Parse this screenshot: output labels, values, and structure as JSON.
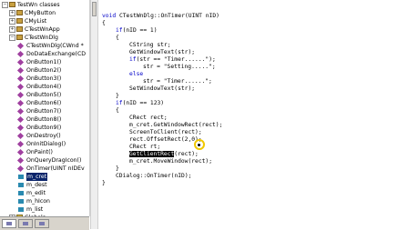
{
  "classview": {
    "items": [
      {
        "label": "TestWn classes",
        "level": 0,
        "icon": "classes-root-icon",
        "exp": "-"
      },
      {
        "label": "CMyButton",
        "level": 1,
        "icon": "class-icon",
        "exp": "+"
      },
      {
        "label": "CMyList",
        "level": 1,
        "icon": "class-icon",
        "exp": "+"
      },
      {
        "label": "CTestWnApp",
        "level": 1,
        "icon": "class-icon",
        "exp": "+"
      },
      {
        "label": "CTestWnDlg",
        "level": 1,
        "icon": "class-icon",
        "exp": "-"
      },
      {
        "label": "CTestWnDlg(CWnd *",
        "level": 2,
        "icon": "method-icon"
      },
      {
        "label": "DoDataExchange(CD",
        "level": 2,
        "icon": "method-icon"
      },
      {
        "label": "OnButton1()",
        "level": 2,
        "icon": "method-icon"
      },
      {
        "label": "OnButton2()",
        "level": 2,
        "icon": "method-icon"
      },
      {
        "label": "OnButton3()",
        "level": 2,
        "icon": "method-icon"
      },
      {
        "label": "OnButton4()",
        "level": 2,
        "icon": "method-icon"
      },
      {
        "label": "OnButton5()",
        "level": 2,
        "icon": "method-icon"
      },
      {
        "label": "OnButton6()",
        "level": 2,
        "icon": "method-icon"
      },
      {
        "label": "OnButton7()",
        "level": 2,
        "icon": "method-icon"
      },
      {
        "label": "OnButton8()",
        "level": 2,
        "icon": "method-icon"
      },
      {
        "label": "OnButton9()",
        "level": 2,
        "icon": "method-icon"
      },
      {
        "label": "OnDestroy()",
        "level": 2,
        "icon": "method-icon"
      },
      {
        "label": "OnInitDialog()",
        "level": 2,
        "icon": "method-icon"
      },
      {
        "label": "OnPaint()",
        "level": 2,
        "icon": "method-icon"
      },
      {
        "label": "OnQueryDragIcon()",
        "level": 2,
        "icon": "method-icon"
      },
      {
        "label": "OnTimer(UINT nIDEv",
        "level": 2,
        "icon": "method-icon"
      },
      {
        "label": "m_cret",
        "level": 2,
        "icon": "member-icon",
        "selected": true
      },
      {
        "label": "m_dest",
        "level": 2,
        "icon": "member-icon"
      },
      {
        "label": "m_edit",
        "level": 2,
        "icon": "member-icon"
      },
      {
        "label": "m_hIcon",
        "level": 2,
        "icon": "member-icon"
      },
      {
        "label": "m_list",
        "level": 2,
        "icon": "member-icon"
      },
      {
        "label": "Globals",
        "level": 1,
        "icon": "globals-icon",
        "exp": "+"
      }
    ]
  },
  "tabs": [
    {
      "name": "class-view-tab",
      "active": true
    },
    {
      "name": "resource-view-tab",
      "active": false
    },
    {
      "name": "file-view-tab",
      "active": false
    }
  ],
  "code": {
    "lines": [
      {
        "indent": 0,
        "parts": [
          {
            "t": "void",
            "c": "kw"
          },
          {
            "t": " CTestWnDlg::OnTimer(UINT nID)"
          }
        ]
      },
      {
        "indent": 0,
        "parts": [
          {
            "t": "{"
          }
        ]
      },
      {
        "indent": 1,
        "parts": [
          {
            "t": "if",
            "c": "kw"
          },
          {
            "t": "(nID == 1)"
          }
        ]
      },
      {
        "indent": 1,
        "parts": [
          {
            "t": "{"
          }
        ]
      },
      {
        "indent": 2,
        "parts": [
          {
            "t": "CString str;"
          }
        ]
      },
      {
        "indent": 2,
        "parts": [
          {
            "t": "GetWindowText(str);"
          }
        ]
      },
      {
        "indent": 2,
        "parts": [
          {
            "t": "if",
            "c": "kw"
          },
          {
            "t": "(str == \"Timer......\");"
          }
        ]
      },
      {
        "indent": 3,
        "parts": [
          {
            "t": "str = \"Setting.....\";"
          }
        ]
      },
      {
        "indent": 2,
        "parts": [
          {
            "t": "else",
            "c": "kw"
          }
        ]
      },
      {
        "indent": 3,
        "parts": [
          {
            "t": "str = \"Timer......\";"
          }
        ]
      },
      {
        "indent": 2,
        "parts": [
          {
            "t": "SetWindowText(str);"
          }
        ]
      },
      {
        "indent": 1,
        "parts": [
          {
            "t": "}"
          }
        ]
      },
      {
        "indent": 1,
        "parts": [
          {
            "t": "if",
            "c": "kw"
          },
          {
            "t": "(nID == 123)"
          }
        ]
      },
      {
        "indent": 1,
        "parts": [
          {
            "t": "{"
          }
        ]
      },
      {
        "indent": 2,
        "parts": [
          {
            "t": "CRect rect;"
          }
        ]
      },
      {
        "indent": 2,
        "parts": [
          {
            "t": "m_cret.GetWindowRect(rect);"
          }
        ]
      },
      {
        "indent": 2,
        "parts": [
          {
            "t": "ScreenToClient(rect);"
          }
        ]
      },
      {
        "indent": 2,
        "parts": [
          {
            "t": "rect.OffsetRect(2,0);"
          }
        ]
      },
      {
        "indent": 2,
        "parts": [
          {
            "t": "CRect rt;"
          }
        ]
      },
      {
        "indent": 2,
        "parts": [
          {
            "t": "GetClientRect",
            "c": "hl"
          },
          {
            "t": "(rect);"
          }
        ]
      },
      {
        "indent": 2,
        "parts": [
          {
            "t": "m_cret.MoveWindow(rect);"
          }
        ]
      },
      {
        "indent": 1,
        "parts": [
          {
            "t": "}"
          }
        ]
      },
      {
        "indent": 1,
        "parts": [
          {
            "t": "CDialog::OnTimer(nID);"
          }
        ]
      },
      {
        "indent": 0,
        "parts": [
          {
            "t": "}"
          }
        ]
      }
    ]
  },
  "colors": {
    "keyword": "#0000c8",
    "selection": "#0a246a",
    "cursor_ring": "#f0c800"
  }
}
